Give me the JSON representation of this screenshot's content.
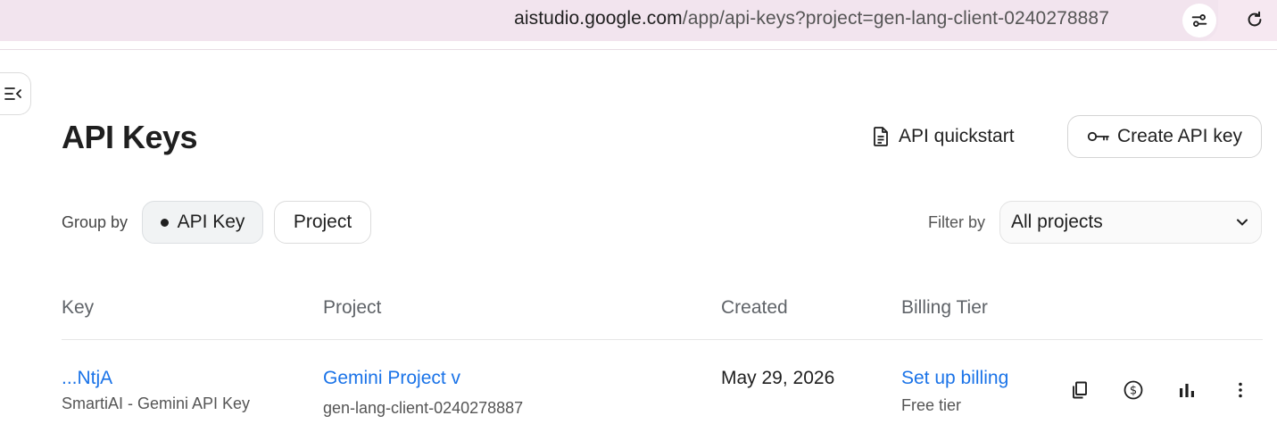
{
  "browser": {
    "url_host": "aistudio.google.com",
    "url_path": "/app/api-keys?project=gen-lang-client-0240278887",
    "icons": {
      "site_settings": "tune-icon",
      "reload": "reload-icon"
    }
  },
  "sidebar": {
    "toggle_icon": "menu-collapse-icon"
  },
  "header": {
    "title": "API Keys",
    "quickstart_label": "API quickstart",
    "create_label": "Create API key",
    "icons": {
      "quickstart": "document-icon",
      "create": "key-icon"
    }
  },
  "toolbar": {
    "group_by_label": "Group by",
    "group_options": [
      "API Key",
      "Project"
    ],
    "group_selected": "API Key",
    "filter_label": "Filter by",
    "filter_value": "All projects"
  },
  "table": {
    "columns": [
      "Key",
      "Project",
      "Created",
      "Billing Tier"
    ],
    "rows": [
      {
        "key": "...NtjA",
        "key_name": "SmartiAI - Gemini API Key",
        "project": "Gemini Project v",
        "project_id": "gen-lang-client-0240278887",
        "created": "May 29, 2026",
        "billing_action": "Set up billing",
        "billing_tier": "Free tier",
        "actions": [
          "copy-icon",
          "billing-icon",
          "usage-chart-icon",
          "more-vert-icon"
        ]
      }
    ]
  },
  "colors": {
    "link": "#1a73e8",
    "address_bar": "#f2e4ee",
    "text": "#1f1f1f",
    "muted": "#5f6368"
  }
}
